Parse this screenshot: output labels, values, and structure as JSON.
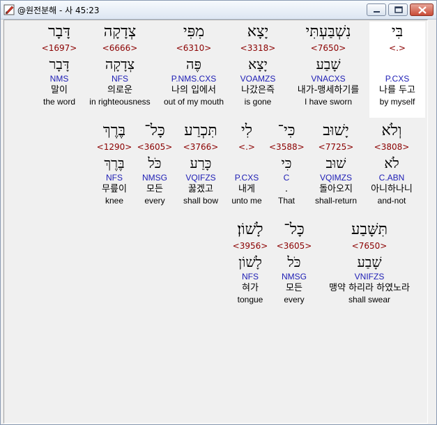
{
  "window": {
    "title": "@원전분해 - 사 45:23",
    "colors": {
      "heb": "#000000",
      "strong": "#8b0000",
      "morph": "#1c1cb4"
    }
  },
  "row1": [
    {
      "heb": "בִּי",
      "strong": "<.>",
      "lemma": "",
      "morph": "P.CXS",
      "kor": "나를 두고",
      "eng": "by myself",
      "hl": true
    },
    {
      "heb": "נִשְׁבַּעְתִּי",
      "strong": "<7650>",
      "lemma": "שָׁבַע",
      "morph": "VNACXS",
      "kor": "내가-맹세하기를",
      "eng": "I have sworn"
    },
    {
      "heb": "יָצָא",
      "strong": "<3318>",
      "lemma": "יָצָא",
      "morph": "VOAMZS",
      "kor": "나갔은즉",
      "eng": "is gone"
    },
    {
      "heb": "מִפִּי",
      "strong": "<6310>",
      "lemma": "פֶּה",
      "morph": "P.NMS.CXS",
      "kor": "나의 입에서",
      "eng": "out of my mouth"
    },
    {
      "heb": "צְדָקָה",
      "strong": "<6666>",
      "lemma": "צְדָקָה",
      "morph": "NFS",
      "kor": "의로운",
      "eng": "in righteousness"
    },
    {
      "heb": "דָּבָר",
      "strong": "<1697>",
      "lemma": "דָּבָר",
      "morph": "NMS",
      "kor": "말이",
      "eng": "the word"
    }
  ],
  "row2": [
    {
      "heb": "וְלֹא",
      "strong": "<3808>",
      "lemma": "לֹא",
      "morph": "C.ABN",
      "kor": "아니하나니",
      "eng": "and-not"
    },
    {
      "heb": "יָשׁוּב",
      "strong": "<7725>",
      "lemma": "שׁוּב",
      "morph": "VQIMZS",
      "kor": "돌아오지",
      "eng": "shall-return"
    },
    {
      "heb": "כִּי־",
      "strong": "<3588>",
      "lemma": "כִּי",
      "morph": "C",
      "kor": ".",
      "eng": "That"
    },
    {
      "heb": "לִי",
      "strong": "<.>",
      "lemma": "",
      "morph": "P.CXS",
      "kor": "내게",
      "eng": "unto me"
    },
    {
      "heb": "תִּכְרַע",
      "strong": "<3766>",
      "lemma": "כָּרַע",
      "morph": "VQIFZS",
      "kor": "꿇겠고",
      "eng": "shall bow"
    },
    {
      "heb": "כָּל־",
      "strong": "<3605>",
      "lemma": "כֹּל",
      "morph": "NMSG",
      "kor": "모든",
      "eng": "every"
    },
    {
      "heb": "בֶּרֶךְ",
      "strong": "<1290>",
      "lemma": "בֶּרֶךְ",
      "morph": "NFS",
      "kor": "무릎이",
      "eng": "knee"
    }
  ],
  "row3": [
    {
      "heb": "תִּשָּׁבַע",
      "strong": "<7650>",
      "lemma": "שָׁבַע",
      "morph": "VNIFZS",
      "kor": "맹약 하리라 하였노라",
      "eng": "shall swear"
    },
    {
      "heb": "כָּל־",
      "strong": "<3605>",
      "lemma": "כֹּל",
      "morph": "NMSG",
      "kor": "모든",
      "eng": "every"
    },
    {
      "heb": "לָשׁוֹן׃",
      "strong": "<3956>",
      "lemma": "לָשׁוֹן",
      "morph": "NFS",
      "kor": "혀가",
      "eng": "tongue"
    }
  ]
}
